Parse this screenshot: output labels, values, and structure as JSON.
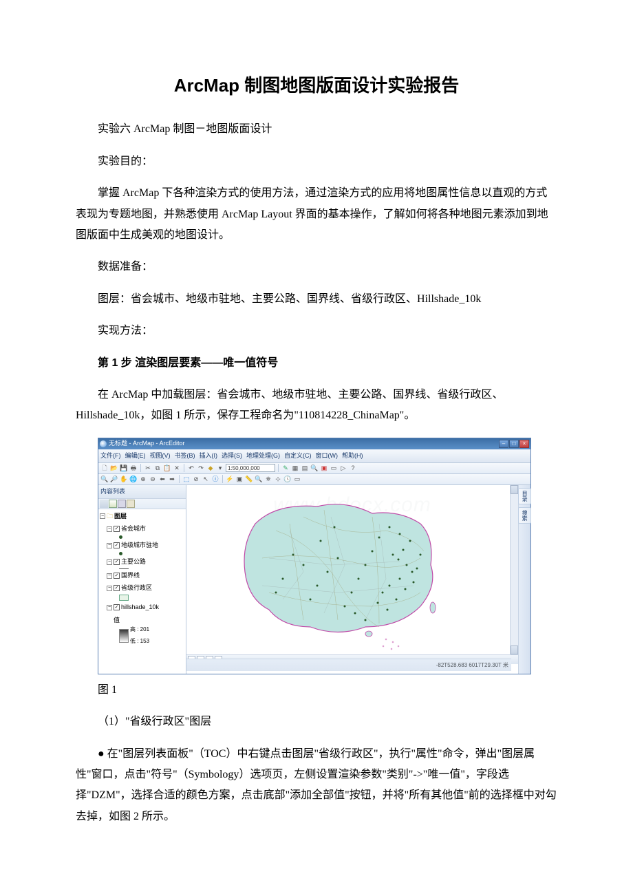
{
  "doc": {
    "title": "ArcMap 制图地图版面设计实验报告",
    "p1": "实验六 ArcMap 制图－地图版面设计",
    "p2": "实验目的：",
    "p3": "掌握 ArcMap 下各种渲染方式的使用方法，通过渲染方式的应用将地图属性信息以直观的方式表现为专题地图，并熟悉使用 ArcMap Layout 界面的基本操作，了解如何将各种地图元素添加到地图版面中生成美观的地图设计。",
    "p4": "数据准备：",
    "p5": "图层：省会城市、地级市驻地、主要公路、国界线、省级行政区、Hillshade_10k",
    "p6": "实现方法：",
    "step1": "第 1 步 渲染图层要素——唯一值符号",
    "p7": "在 ArcMap 中加载图层：省会城市、地级市驻地、主要公路、国界线、省级行政区、Hillshade_10k，如图 1 所示，保存工程命名为\"110814228_ChinaMap\"。",
    "fig1": "图 1",
    "p8": "（1）\"省级行政区\"图层",
    "p9": "● 在\"图层列表面板\"（TOC）中右键点击图层\"省级行政区\"，执行\"属性\"命令，弹出\"图层属性\"窗口，点击\"符号\"（Symbology）选项页，左侧设置渲染参数\"类别\"->\"唯一值\"，字段选择\"DZM\"，选择合适的颜色方案，点击底部\"添加全部值\"按钮，并将\"所有其他值\"前的选择框中对勾去掉，如图 2 所示。"
  },
  "app": {
    "title": "无标题 - ArcMap - ArcEditor",
    "menus": [
      "文件(F)",
      "编辑(E)",
      "视图(V)",
      "书签(B)",
      "插入(I)",
      "选择(S)",
      "地理处理(G)",
      "自定义(C)",
      "窗口(W)",
      "帮助(H)"
    ],
    "scale": "1:50,000,000",
    "toc_title": "内容列表",
    "root": "图层",
    "layers": [
      "省会城市",
      "地级城市驻地",
      "主要公路",
      "国界线",
      "省级行政区",
      "hillshade_10k"
    ],
    "raster_label": "值",
    "raster_high": "高 : 201",
    "raster_low": "低 : 153",
    "side_tab1": "目录",
    "side_tab2": "搜索",
    "status": "-82T528.683  6017T29.30T 米",
    "watermark": "www.bdocx.com"
  }
}
